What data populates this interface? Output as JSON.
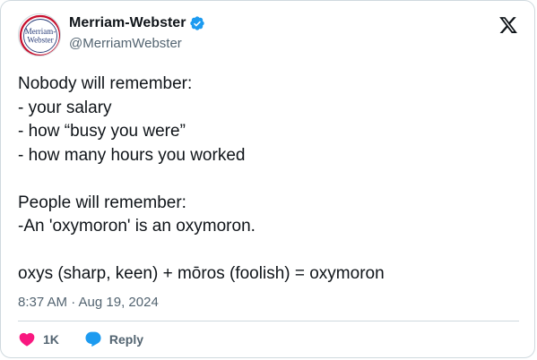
{
  "author": {
    "display_name": "Merriam-Webster",
    "handle": "@MerriamWebster",
    "avatar_text": [
      "Merriam-",
      "Webster"
    ],
    "verified": true,
    "verified_icon": "verified-badge-icon"
  },
  "platform_icon": "x-logo-icon",
  "tweet": {
    "lines": [
      "Nobody will remember:",
      "- your salary",
      "- how “busy you were”",
      "- how many hours you worked",
      "",
      "People will remember:",
      "-An 'oxymoron' is an oxymoron.",
      "",
      "oxys (sharp, keen) + mōros (foolish) = oxymoron"
    ]
  },
  "timestamp": "8:37 AM · Aug 19, 2024",
  "actions": {
    "like_count": "1K",
    "reply_label": "Reply"
  },
  "colors": {
    "text": "#0f1419",
    "secondary": "#536471",
    "border": "#cfd9de",
    "like": "#f91880",
    "reply": "#1d9bf0",
    "verified": "#1d9bf0",
    "brand_red": "#c8102e",
    "brand_blue": "#2b3f7a"
  }
}
